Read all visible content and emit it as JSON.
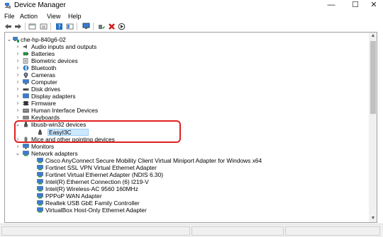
{
  "window": {
    "title": "Device Manager",
    "minimize": "—",
    "maximize": "☐",
    "close": "✕"
  },
  "menu": [
    "File",
    "Action",
    "View",
    "Help"
  ],
  "toolbar": {
    "buttons": [
      "back-icon",
      "forward-icon",
      "properties-pane-icon",
      "list-icon",
      "help-icon",
      "details-icon",
      "monitor-icon",
      "update-driver-icon",
      "uninstall-icon",
      "scan-icon"
    ],
    "colors": {
      "green": "#1e9c3c",
      "red": "#d01818",
      "blue": "#1f6fc4"
    }
  },
  "tree": {
    "root": "che-hp-840g6-02",
    "categories": [
      {
        "label": "Audio inputs and outputs",
        "icon": "speaker-icon",
        "expanded": false
      },
      {
        "label": "Batteries",
        "icon": "battery-icon",
        "expanded": false
      },
      {
        "label": "Biometric devices",
        "icon": "biometric-icon",
        "expanded": false
      },
      {
        "label": "Bluetooth",
        "icon": "bluetooth-icon",
        "expanded": false
      },
      {
        "label": "Cameras",
        "icon": "camera-icon",
        "expanded": false
      },
      {
        "label": "Computer",
        "icon": "computer-icon",
        "expanded": false
      },
      {
        "label": "Disk drives",
        "icon": "disk-icon",
        "expanded": false
      },
      {
        "label": "Display adapters",
        "icon": "display-icon",
        "expanded": false
      },
      {
        "label": "Firmware",
        "icon": "firmware-icon",
        "expanded": false
      },
      {
        "label": "Human Interface Devices",
        "icon": "hid-icon",
        "expanded": false
      },
      {
        "label": "Keyboards",
        "icon": "keyboard-icon",
        "expanded": false
      },
      {
        "label": "libusb-win32 devices",
        "icon": "usb-icon",
        "expanded": true
      },
      {
        "label": "Mice and other pointing devices",
        "icon": "mouse-icon",
        "expanded": false
      },
      {
        "label": "Monitors",
        "icon": "monitor-icon",
        "expanded": false
      },
      {
        "label": "Network adapters",
        "icon": "network-icon",
        "expanded": true
      }
    ],
    "libusb_children": [
      "EasyI3C"
    ],
    "network_children": [
      "Cisco AnyConnect Secure Mobility Client Virtual Miniport Adapter for Windows x64",
      "Fortinet SSL VPN Virtual Ethernet Adapter",
      "Fortinet Virtual Ethernet Adapter (NDIS 6.30)",
      "Intel(R) Ethernet Connection (6) I219-V",
      "Intel(R) Wireless-AC 9560 160MHz",
      "PPPoP WAN Adapter",
      "Realtek USB GbE Family Controller",
      "VirtualBox Host-Only Ethernet Adapter"
    ],
    "selected": "EasyI3C"
  },
  "annotation": {
    "color": "#e02020"
  }
}
